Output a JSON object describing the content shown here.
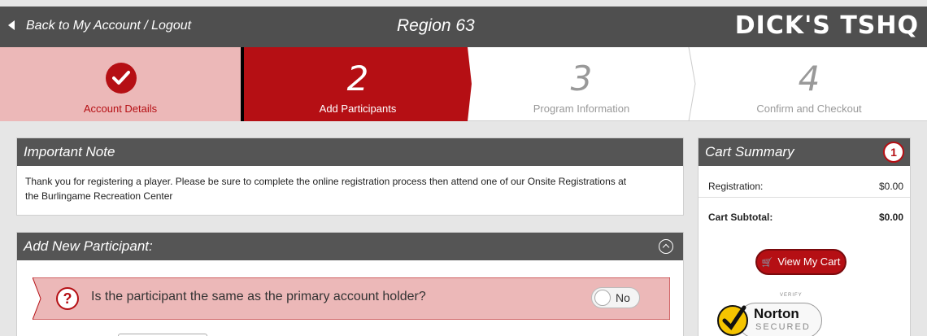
{
  "topbar": {
    "back_label": "Back to My Account / Logout",
    "title": "Region 63",
    "logo": "DICK'S TSHQ"
  },
  "steps": [
    {
      "number": "",
      "label": "Account Details",
      "state": "complete"
    },
    {
      "number": "2",
      "label": "Add Participants",
      "state": "active"
    },
    {
      "number": "3",
      "label": "Program Information",
      "state": "pending"
    },
    {
      "number": "4",
      "label": "Confirm and Checkout",
      "state": "pending"
    }
  ],
  "note": {
    "title": "Important Note",
    "text_line1": "Thank you for registering a player.  Please be sure to complete the online registration process then attend one of our Onsite Registrations at",
    "text_line2": "the Burlingame Recreation Center"
  },
  "add_participant": {
    "title": "Add New Participant:",
    "question": "Is the participant the same as the primary account holder?",
    "toggle_label": "No"
  },
  "cart": {
    "title": "Cart Summary",
    "count": "1",
    "registration_label": "Registration:",
    "registration_value": "$0.00",
    "subtotal_label": "Cart Subtotal:",
    "subtotal_value": "$0.00",
    "view_cart_label": "View My Cart"
  },
  "norton": {
    "verify": "VERIFY",
    "brand": "Norton",
    "secured": "SECURED"
  },
  "colors": {
    "accent": "#b50f14",
    "header_bg": "#4f4f4f",
    "complete_bg": "#ecb8b8"
  }
}
